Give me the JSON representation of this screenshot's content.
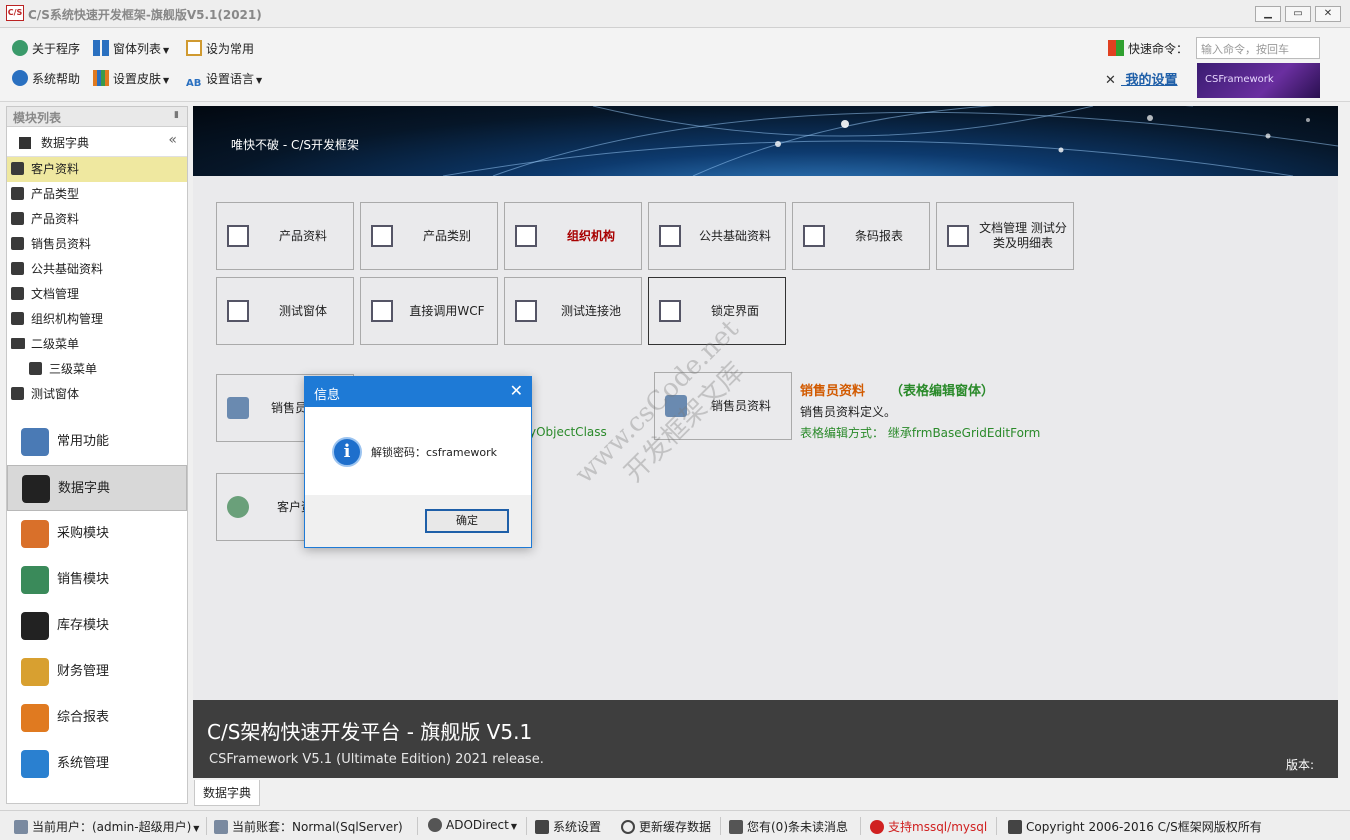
{
  "window": {
    "logo": "C/S",
    "title": "C/S系统快速开发框架-旗舰版V5.1(2021)",
    "buttons": {
      "minimize": "▁",
      "maximize": "▭",
      "close": "✕"
    }
  },
  "toolbar": {
    "about": "关于程序",
    "window_list": "窗体列表",
    "set_common": "设为常用",
    "help": "系统帮助",
    "skin": "设置皮肤",
    "language": "设置语言",
    "quick_cmd_label": "快速命令：",
    "quick_cmd_placeholder": "输入命令，按回车",
    "my_settings": "我的设置",
    "banner": "CSFramework"
  },
  "sidebar": {
    "header": "模块列表",
    "group": "数据字典",
    "tree": [
      {
        "label": "客户资料",
        "type": "cube",
        "selected": true,
        "indent": 0
      },
      {
        "label": "产品类型",
        "type": "cube",
        "indent": 0
      },
      {
        "label": "产品资料",
        "type": "cube",
        "indent": 0
      },
      {
        "label": "销售员资料",
        "type": "cube",
        "indent": 0
      },
      {
        "label": "公共基础资料",
        "type": "cube",
        "indent": 0
      },
      {
        "label": "文档管理",
        "type": "cube",
        "indent": 0
      },
      {
        "label": "组织机构管理",
        "type": "cube",
        "indent": 0
      },
      {
        "label": "二级菜单",
        "type": "folder",
        "indent": 0
      },
      {
        "label": "三级菜单",
        "type": "cube",
        "indent": 1
      },
      {
        "label": "测试窗体",
        "type": "cube",
        "indent": 0
      }
    ],
    "nav": [
      {
        "label": "常用功能",
        "icon": "user-pin-icon",
        "color": "#4a7ab5"
      },
      {
        "label": "数据字典",
        "icon": "org-chart-icon",
        "color": "#222222",
        "active": true
      },
      {
        "label": "采购模块",
        "icon": "cart-icon",
        "color": "#d9702a"
      },
      {
        "label": "销售模块",
        "icon": "sales-doc-icon",
        "color": "#3a8a5a"
      },
      {
        "label": "库存模块",
        "icon": "house-icon",
        "color": "#222222"
      },
      {
        "label": "财务管理",
        "icon": "money-icon",
        "color": "#d8a030"
      },
      {
        "label": "综合报表",
        "icon": "bar-chart-icon",
        "color": "#e07a20"
      },
      {
        "label": "系统管理",
        "icon": "windows-icon",
        "color": "#2a80d0"
      }
    ]
  },
  "main": {
    "banner_text": "唯快不破 - C/S开发框架",
    "tiles_row1": [
      {
        "label": "产品资料",
        "icon": "doc-icon"
      },
      {
        "label": "产品类别",
        "icon": "grid-icon"
      },
      {
        "label": "组织机构",
        "icon": "org-icon",
        "highlight": true
      },
      {
        "label": "公共基础资料",
        "icon": "list-icon"
      },
      {
        "label": "条码报表",
        "icon": "barcode-icon"
      },
      {
        "label": "文档管理 测试分类及明细表",
        "icon": "lines-icon"
      }
    ],
    "tiles_row2": [
      {
        "label": "测试窗体",
        "icon": "edit-icon"
      },
      {
        "label": "直接调用WCF",
        "icon": "tools-icon"
      },
      {
        "label": "测试连接池",
        "icon": "pool-icon"
      },
      {
        "label": "锁定界面",
        "icon": "lock-doc-icon",
        "dark": true
      }
    ],
    "tile_sales_left": "销售员",
    "tile_customer": "客户资",
    "tile_sales_right": "销售员资料",
    "partial_text": "yObjectClass",
    "info": {
      "title": "销售员资料",
      "subtitle": "（表格编辑窗体）",
      "desc": "销售员资料定义。",
      "mode": "表格编辑方式：  继承frmBaseGridEditForm"
    },
    "footer": {
      "title": "C/S架构快速开发平台 - 旗舰版 V5.1",
      "subtitle": "CSFramework V5.1 (Ultimate Edition) 2021 release.",
      "version_label": "版本:"
    },
    "tab": "数据字典"
  },
  "watermark": {
    "line1": "www.csCode.net",
    "line2": "开发框架文库"
  },
  "dialog": {
    "title": "信息",
    "icon_glyph": "i",
    "message": "解锁密码：csframework",
    "ok": "确定"
  },
  "status": {
    "user": "当前用户：(admin-超级用户)",
    "account": "当前账套：Normal(SqlServer)",
    "ado": "ADODirect",
    "settings": "系统设置",
    "refresh": "更新缓存数据",
    "messages": "您有(0)条未读消息",
    "support": "支持mssql/mysql",
    "copyright": "Copyright 2006-2016 C/S框架网版权所有",
    "support_color": "#d02020"
  }
}
